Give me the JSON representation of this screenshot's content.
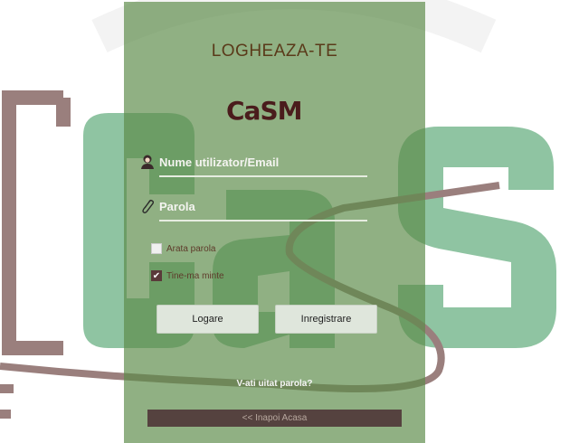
{
  "login": {
    "title": "LOGHEAZA-TE",
    "logo_text": "CaSM",
    "username_label": "Nume utilizator/Email",
    "password_label": "Parola",
    "show_password_label": "Arata parola",
    "show_password_checked": false,
    "remember_label": "Tine-ma minte",
    "remember_checked": true,
    "login_button": "Logare",
    "register_button": "Inregistrare",
    "forgot_link": "V-ati uitat parola?",
    "home_link": "<< Inapoi Acasa"
  },
  "colors": {
    "panel": "#5c8a48",
    "background_letters": "#8fc4a2",
    "background_outline": "#8a6e6a",
    "title": "#5a3a1a"
  }
}
